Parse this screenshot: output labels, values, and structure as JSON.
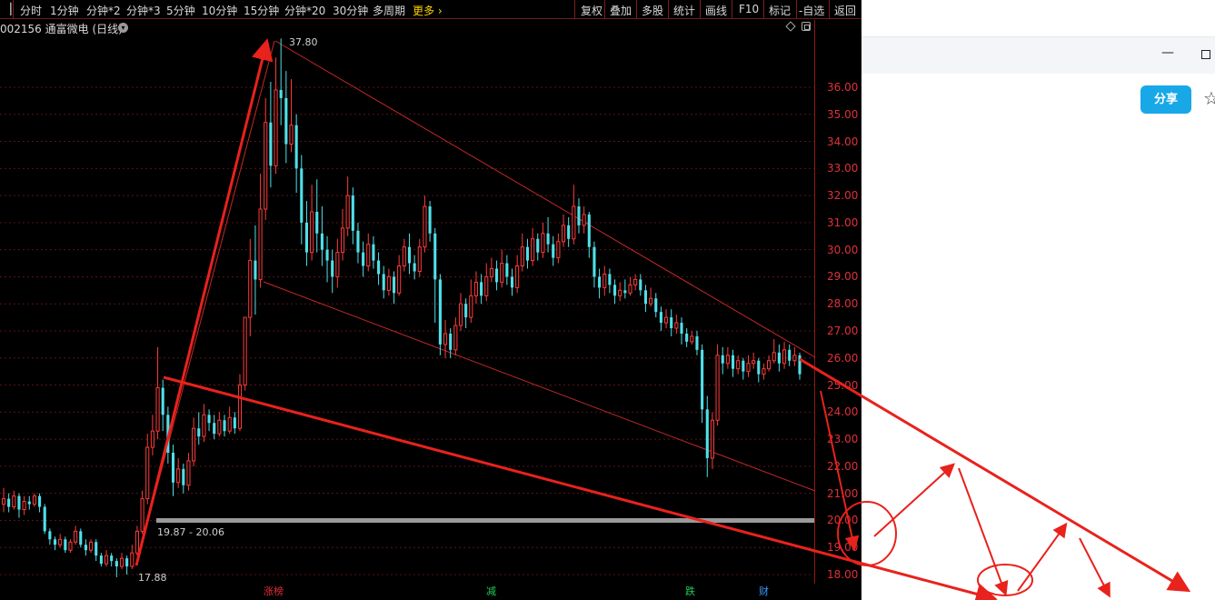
{
  "toolbar": {
    "left_items": [
      "分时",
      "1分钟",
      "分钟*2",
      "分钟*3",
      "5分钟",
      "10分钟",
      "15分钟",
      "分钟*20",
      "30分钟",
      "多周期"
    ],
    "more_label": "更多 ›",
    "right_buttons": [
      "复权",
      "叠加",
      "多股",
      "统计",
      "画线",
      "F10",
      "标记",
      "-自选",
      "返回"
    ]
  },
  "stock": {
    "title": "002156 通富微电 (日线)"
  },
  "chart_data": {
    "type": "candlestick",
    "y_ticks": [
      "36.00",
      "35.00",
      "34.00",
      "33.00",
      "32.00",
      "31.00",
      "30.00",
      "29.00",
      "28.00",
      "27.00",
      "26.00",
      "25.00",
      "24.00",
      "23.00",
      "22.00",
      "21.00",
      "20.00",
      "19.00",
      "18.00"
    ],
    "ylim": [
      17.6,
      37.8
    ],
    "high_label": "37.80",
    "low_label": "17.88",
    "zone_label": "19.87 - 20.06",
    "zone": [
      19.87,
      20.06
    ],
    "event_markers": [
      "涨榜",
      "减",
      "跌",
      "财"
    ],
    "candles": [
      [
        20.6,
        20.8,
        21.2,
        20.3
      ],
      [
        20.8,
        20.5,
        21.0,
        20.3
      ],
      [
        20.5,
        20.9,
        21.1,
        20.4
      ],
      [
        20.9,
        20.4,
        21.0,
        20.1
      ],
      [
        20.4,
        20.7,
        20.9,
        20.2
      ],
      [
        20.7,
        20.6,
        20.9,
        20.4
      ],
      [
        20.6,
        20.9,
        21.0,
        20.5
      ],
      [
        20.9,
        20.5,
        21.0,
        20.3
      ],
      [
        20.5,
        19.6,
        20.6,
        19.5
      ],
      [
        19.6,
        19.3,
        19.7,
        19.1
      ],
      [
        19.3,
        19.1,
        19.4,
        18.9
      ],
      [
        19.1,
        19.3,
        19.5,
        19.0
      ],
      [
        19.3,
        18.9,
        19.4,
        18.8
      ],
      [
        18.9,
        19.2,
        19.3,
        18.8
      ],
      [
        19.2,
        19.6,
        19.8,
        19.1
      ],
      [
        19.6,
        19.1,
        19.7,
        19.0
      ],
      [
        19.1,
        18.9,
        19.3,
        18.7
      ],
      [
        18.9,
        19.2,
        19.3,
        18.8
      ],
      [
        19.2,
        18.7,
        19.3,
        18.5
      ],
      [
        18.7,
        18.4,
        18.8,
        18.3
      ],
      [
        18.4,
        18.7,
        18.9,
        18.3
      ],
      [
        18.7,
        18.5,
        18.8,
        18.3
      ],
      [
        18.5,
        18.3,
        18.6,
        17.9
      ],
      [
        18.3,
        18.6,
        18.8,
        18.2
      ],
      [
        18.6,
        18.3,
        18.7,
        18.0
      ],
      [
        18.3,
        18.8,
        19.1,
        18.2
      ],
      [
        18.8,
        19.6,
        19.8,
        18.7
      ],
      [
        19.6,
        20.8,
        21.1,
        19.5
      ],
      [
        20.8,
        22.7,
        23.2,
        20.6
      ],
      [
        22.7,
        23.3,
        23.9,
        22.4
      ],
      [
        23.3,
        24.9,
        26.4,
        23.0
      ],
      [
        24.9,
        23.9,
        25.2,
        23.3
      ],
      [
        23.9,
        22.5,
        24.2,
        22.1
      ],
      [
        22.5,
        21.4,
        22.8,
        20.9
      ],
      [
        21.4,
        21.9,
        22.3,
        21.2
      ],
      [
        21.9,
        21.3,
        22.1,
        21.0
      ],
      [
        21.3,
        22.2,
        22.5,
        21.1
      ],
      [
        22.2,
        23.4,
        23.8,
        22.0
      ],
      [
        23.4,
        23.1,
        24.0,
        22.8
      ],
      [
        23.1,
        23.9,
        24.3,
        22.9
      ],
      [
        23.9,
        23.6,
        24.1,
        23.3
      ],
      [
        23.6,
        23.2,
        23.9,
        23.0
      ],
      [
        23.2,
        23.7,
        24.0,
        23.1
      ],
      [
        23.7,
        23.3,
        23.9,
        23.1
      ],
      [
        23.3,
        23.8,
        24.2,
        23.2
      ],
      [
        23.8,
        23.4,
        24.0,
        23.2
      ],
      [
        23.4,
        25.0,
        25.4,
        23.3
      ],
      [
        25.0,
        27.5,
        27.5,
        24.8
      ],
      [
        27.5,
        29.6,
        30.4,
        26.8
      ],
      [
        29.6,
        28.9,
        30.9,
        27.6
      ],
      [
        28.9,
        31.5,
        32.8,
        28.6
      ],
      [
        31.5,
        34.7,
        35.6,
        31.1
      ],
      [
        34.7,
        33.1,
        36.2,
        32.3
      ],
      [
        33.1,
        35.9,
        37.1,
        32.8
      ],
      [
        35.9,
        35.6,
        37.8,
        34.6
      ],
      [
        35.6,
        33.9,
        36.6,
        33.2
      ],
      [
        33.9,
        34.6,
        36.3,
        33.6
      ],
      [
        34.6,
        33.0,
        35.0,
        32.1
      ],
      [
        33.0,
        31.0,
        33.5,
        30.2
      ],
      [
        31.0,
        29.9,
        31.8,
        29.4
      ],
      [
        29.9,
        31.4,
        32.4,
        29.6
      ],
      [
        31.4,
        30.6,
        32.6,
        29.9
      ],
      [
        30.6,
        30.0,
        31.6,
        29.4
      ],
      [
        30.0,
        29.6,
        30.5,
        28.8
      ],
      [
        29.6,
        29.0,
        30.0,
        28.4
      ],
      [
        29.0,
        29.9,
        30.4,
        28.6
      ],
      [
        29.9,
        30.8,
        31.5,
        29.6
      ],
      [
        30.8,
        32.0,
        32.7,
        30.5
      ],
      [
        32.0,
        30.7,
        32.3,
        30.2
      ],
      [
        30.7,
        29.9,
        31.0,
        29.5
      ],
      [
        29.9,
        29.4,
        30.3,
        29.0
      ],
      [
        29.4,
        30.2,
        30.6,
        29.2
      ],
      [
        30.2,
        29.6,
        30.5,
        29.3
      ],
      [
        29.6,
        29.1,
        29.9,
        28.7
      ],
      [
        29.1,
        28.5,
        29.4,
        28.2
      ],
      [
        28.5,
        29.0,
        29.3,
        28.3
      ],
      [
        29.0,
        28.4,
        29.2,
        28.0
      ],
      [
        28.4,
        29.4,
        29.8,
        28.3
      ],
      [
        29.4,
        30.1,
        30.4,
        29.2
      ],
      [
        30.1,
        29.5,
        30.6,
        29.1
      ],
      [
        29.5,
        29.2,
        29.8,
        28.9
      ],
      [
        29.2,
        30.1,
        30.4,
        29.0
      ],
      [
        30.1,
        31.6,
        32.0,
        29.9
      ],
      [
        31.6,
        30.6,
        31.8,
        30.3
      ],
      [
        30.6,
        28.9,
        30.8,
        27.3
      ],
      [
        28.9,
        26.5,
        29.1,
        26.1
      ],
      [
        26.5,
        26.9,
        27.4,
        26.0
      ],
      [
        26.9,
        26.3,
        27.1,
        26.0
      ],
      [
        26.3,
        27.2,
        27.5,
        26.1
      ],
      [
        27.2,
        28.0,
        28.4,
        27.0
      ],
      [
        28.0,
        27.5,
        28.2,
        27.1
      ],
      [
        27.5,
        28.3,
        28.9,
        27.3
      ],
      [
        28.3,
        28.8,
        29.2,
        28.0
      ],
      [
        28.8,
        28.3,
        29.1,
        28.0
      ],
      [
        28.3,
        29.0,
        29.5,
        28.1
      ],
      [
        29.0,
        29.3,
        29.7,
        28.8
      ],
      [
        29.3,
        28.8,
        29.6,
        28.5
      ],
      [
        28.8,
        29.5,
        30.0,
        28.6
      ],
      [
        29.5,
        29.0,
        29.8,
        28.7
      ],
      [
        29.0,
        28.6,
        29.3,
        28.3
      ],
      [
        28.6,
        29.4,
        29.8,
        28.4
      ],
      [
        29.4,
        30.1,
        30.6,
        29.2
      ],
      [
        30.1,
        29.6,
        30.4,
        29.3
      ],
      [
        29.6,
        30.4,
        30.8,
        29.4
      ],
      [
        30.4,
        29.9,
        30.6,
        29.6
      ],
      [
        29.9,
        30.6,
        31.0,
        29.7
      ],
      [
        30.6,
        30.2,
        31.2,
        29.9
      ],
      [
        30.2,
        29.7,
        30.5,
        29.4
      ],
      [
        29.7,
        30.3,
        30.6,
        29.5
      ],
      [
        30.3,
        30.9,
        31.3,
        30.1
      ],
      [
        30.9,
        30.4,
        31.2,
        30.1
      ],
      [
        30.4,
        31.6,
        32.4,
        30.2
      ],
      [
        31.6,
        30.9,
        31.9,
        30.6
      ],
      [
        30.9,
        31.3,
        31.6,
        30.6
      ],
      [
        31.3,
        30.1,
        31.4,
        29.7
      ],
      [
        30.1,
        29.0,
        30.3,
        28.6
      ],
      [
        29.0,
        28.6,
        29.3,
        28.2
      ],
      [
        28.6,
        29.1,
        29.4,
        28.3
      ],
      [
        29.1,
        28.7,
        29.3,
        28.4
      ],
      [
        28.7,
        28.3,
        28.9,
        28.0
      ],
      [
        28.3,
        28.5,
        28.8,
        28.1
      ],
      [
        28.5,
        28.4,
        28.9,
        28.2
      ],
      [
        28.4,
        28.7,
        29.0,
        28.3
      ],
      [
        28.7,
        28.9,
        29.1,
        28.5
      ],
      [
        28.9,
        28.5,
        29.1,
        28.3
      ],
      [
        28.5,
        28.0,
        28.7,
        27.7
      ],
      [
        28.0,
        28.2,
        28.6,
        27.9
      ],
      [
        28.2,
        27.7,
        28.4,
        27.5
      ],
      [
        27.7,
        27.3,
        27.9,
        27.0
      ],
      [
        27.3,
        27.5,
        27.8,
        27.1
      ],
      [
        27.5,
        27.1,
        27.8,
        26.8
      ],
      [
        27.1,
        27.3,
        27.6,
        26.9
      ],
      [
        27.3,
        26.9,
        27.5,
        26.5
      ],
      [
        26.9,
        26.6,
        27.1,
        26.4
      ],
      [
        26.6,
        26.8,
        27.0,
        26.5
      ],
      [
        26.8,
        26.3,
        27.0,
        26.1
      ],
      [
        26.3,
        24.1,
        26.5,
        23.6
      ],
      [
        24.1,
        22.3,
        24.6,
        21.6
      ],
      [
        22.3,
        23.7,
        24.0,
        21.9
      ],
      [
        23.7,
        26.1,
        26.5,
        23.5
      ],
      [
        26.1,
        25.8,
        26.4,
        25.4
      ],
      [
        25.8,
        26.1,
        26.4,
        25.6
      ],
      [
        26.1,
        25.6,
        26.3,
        25.3
      ],
      [
        25.6,
        25.9,
        26.1,
        25.4
      ],
      [
        25.9,
        25.5,
        26.0,
        25.2
      ],
      [
        25.5,
        25.8,
        26.1,
        25.3
      ],
      [
        25.8,
        25.9,
        26.2,
        25.6
      ],
      [
        25.9,
        25.4,
        26.0,
        25.1
      ],
      [
        25.4,
        25.6,
        25.8,
        25.2
      ],
      [
        25.6,
        25.9,
        26.1,
        25.5
      ],
      [
        25.9,
        26.2,
        26.7,
        25.8
      ],
      [
        26.2,
        25.8,
        26.5,
        25.5
      ],
      [
        25.8,
        26.3,
        26.6,
        25.6
      ],
      [
        26.3,
        25.9,
        26.5,
        25.7
      ],
      [
        25.9,
        26.1,
        26.4,
        25.7
      ],
      [
        26.1,
        25.4,
        26.2,
        25.2
      ]
    ]
  }
}
